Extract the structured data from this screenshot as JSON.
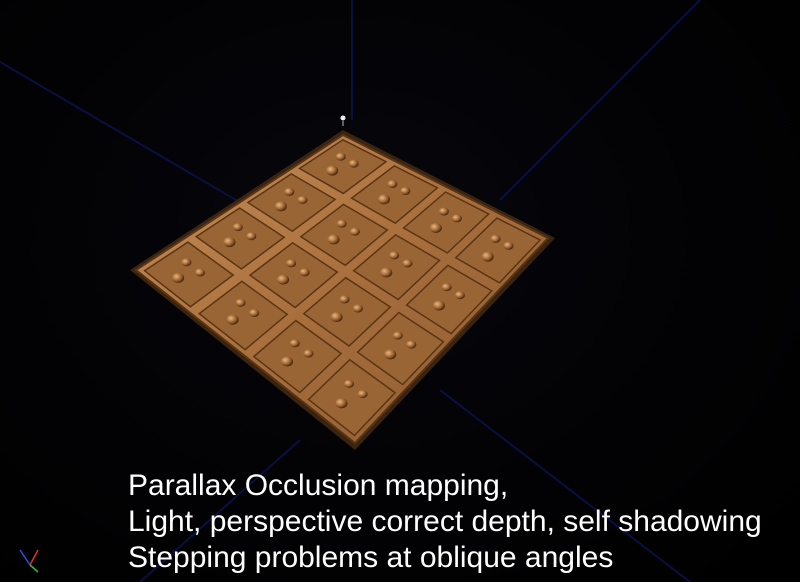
{
  "scene": {
    "background": "#000000",
    "grid_line_color": "#0d1457",
    "plane_wood_color": "#b07a45",
    "plane_groove_color": "#5a3515"
  },
  "caption": {
    "line1": "Parallax Occlusion mapping,",
    "line2": "Light, perspective correct depth, self shadowing",
    "line3": "Stepping problems at oblique angles",
    "color": "#ffffff"
  },
  "axis_gizmo": {
    "x_color": "#e03030",
    "y_color": "#30c030",
    "z_color": "#3050e0"
  },
  "light": {
    "icon": "light-bulb-icon"
  }
}
